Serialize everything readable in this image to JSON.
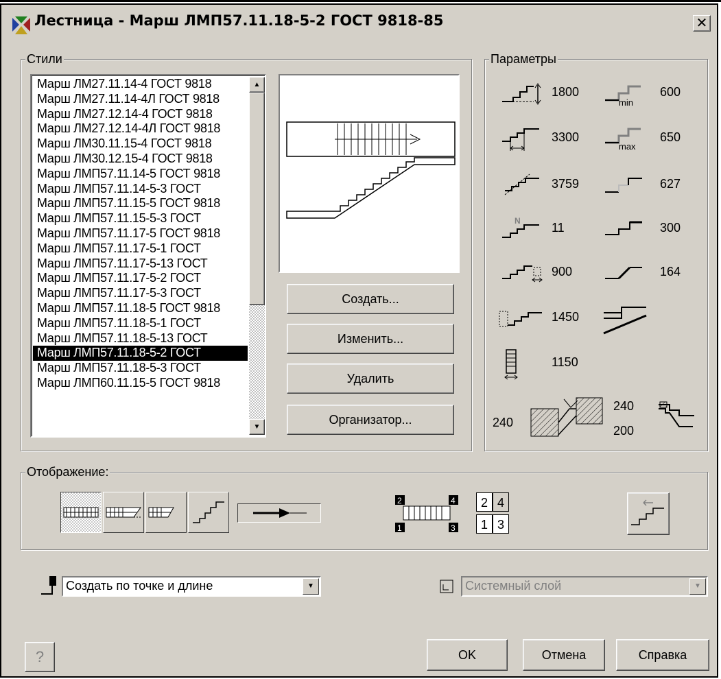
{
  "window": {
    "title": "Лестница - Марш ЛМП57.11.18-5-2 ГОСТ 9818-85",
    "close_glyph": "✕"
  },
  "styles": {
    "label": "Стили",
    "items": [
      "Марш ЛМ27.11.14-4 ГОСТ 9818",
      "Марш ЛМ27.11.14-4Л ГОСТ 9818",
      "Марш ЛМ27.12.14-4 ГОСТ 9818",
      "Марш ЛМ27.12.14-4Л ГОСТ 9818",
      "Марш ЛМ30.11.15-4 ГОСТ 9818",
      "Марш ЛМ30.12.15-4 ГОСТ 9818",
      "Марш ЛМП57.11.14-5 ГОСТ 9818",
      "Марш ЛМП57.11.14-5-3 ГОСТ",
      "Марш ЛМП57.11.15-5 ГОСТ 9818",
      "Марш ЛМП57.11.15-5-3 ГОСТ",
      "Марш ЛМП57.11.17-5 ГОСТ 9818",
      "Марш ЛМП57.11.17-5-1 ГОСТ",
      "Марш ЛМП57.11.17-5-13 ГОСТ",
      "Марш ЛМП57.11.17-5-2 ГОСТ",
      "Марш ЛМП57.11.17-5-3 ГОСТ",
      "Марш ЛМП57.11.18-5 ГОСТ 9818",
      "Марш ЛМП57.11.18-5-1 ГОСТ",
      "Марш ЛМП57.11.18-5-13 ГОСТ",
      "Марш ЛМП57.11.18-5-2 ГОСТ",
      "Марш ЛМП57.11.18-5-3 ГОСТ",
      "Марш ЛМП60.11.15-5 ГОСТ 9818"
    ],
    "selected_index": 18
  },
  "buttons": {
    "create": "Создать...",
    "edit": "Изменить...",
    "delete": "Удалить",
    "organizer": "Организатор..."
  },
  "params": {
    "label": "Параметры",
    "height": "1800",
    "length": "3300",
    "slope_length": "3759",
    "steps": "11",
    "offset": "900",
    "landing": "1450",
    "width": "1150",
    "min": "600",
    "max": "650",
    "stride": "627",
    "tread": "300",
    "riser": "164",
    "min_sub": "min",
    "max_sub": "max",
    "n_glyph": "N",
    "support_left": "240",
    "support_top": "240",
    "support_bottom": "200"
  },
  "display": {
    "label": "Отображение:",
    "cells": [
      "2",
      "4",
      "1",
      "3"
    ],
    "corner_labels": [
      "2",
      "4",
      "1",
      "3"
    ]
  },
  "create_mode": {
    "value": "Создать по точке и длине"
  },
  "layer": {
    "value": "Системный слой"
  },
  "footer": {
    "help_glyph": "?",
    "ok": "OK",
    "cancel": "Отмена",
    "help": "Справка"
  }
}
